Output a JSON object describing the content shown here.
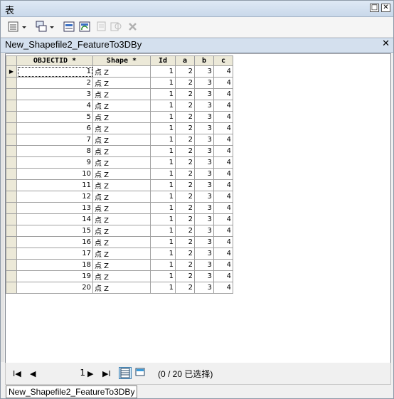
{
  "window": {
    "title": "表",
    "restore_glyph": "□",
    "close_glyph": "✕"
  },
  "toolbar": {
    "icons": [
      "table-options-icon",
      "related-tables-icon",
      "select-by-attributes-icon",
      "switch-selection-icon",
      "clear-selection-icon",
      "zoom-to-selected-icon",
      "delete-selected-icon"
    ]
  },
  "tab": {
    "title": "New_Shapefile2_FeatureTo3DBy",
    "close_glyph": "✕"
  },
  "table": {
    "columns": [
      "OBJECTID *",
      "Shape *",
      "Id",
      "a",
      "b",
      "c"
    ],
    "rows": [
      [
        "1",
        "点 Z",
        "1",
        "2",
        "3",
        "4"
      ],
      [
        "2",
        "点 Z",
        "1",
        "2",
        "3",
        "4"
      ],
      [
        "3",
        "点 Z",
        "1",
        "2",
        "3",
        "4"
      ],
      [
        "4",
        "点 Z",
        "1",
        "2",
        "3",
        "4"
      ],
      [
        "5",
        "点 Z",
        "1",
        "2",
        "3",
        "4"
      ],
      [
        "6",
        "点 Z",
        "1",
        "2",
        "3",
        "4"
      ],
      [
        "7",
        "点 Z",
        "1",
        "2",
        "3",
        "4"
      ],
      [
        "8",
        "点 Z",
        "1",
        "2",
        "3",
        "4"
      ],
      [
        "9",
        "点 Z",
        "1",
        "2",
        "3",
        "4"
      ],
      [
        "10",
        "点 Z",
        "1",
        "2",
        "3",
        "4"
      ],
      [
        "11",
        "点 Z",
        "1",
        "2",
        "3",
        "4"
      ],
      [
        "12",
        "点 Z",
        "1",
        "2",
        "3",
        "4"
      ],
      [
        "13",
        "点 Z",
        "1",
        "2",
        "3",
        "4"
      ],
      [
        "14",
        "点 Z",
        "1",
        "2",
        "3",
        "4"
      ],
      [
        "15",
        "点 Z",
        "1",
        "2",
        "3",
        "4"
      ],
      [
        "16",
        "点 Z",
        "1",
        "2",
        "3",
        "4"
      ],
      [
        "17",
        "点 Z",
        "1",
        "2",
        "3",
        "4"
      ],
      [
        "18",
        "点 Z",
        "1",
        "2",
        "3",
        "4"
      ],
      [
        "19",
        "点 Z",
        "1",
        "2",
        "3",
        "4"
      ],
      [
        "20",
        "点 Z",
        "1",
        "2",
        "3",
        "4"
      ]
    ],
    "current_row_glyph": "▶"
  },
  "nav": {
    "first_glyph": "I◀",
    "prev_glyph": "◀",
    "record": "1",
    "next_glyph": "▶",
    "last_glyph": "▶I",
    "selection_status": "(0 / 20 已选择)"
  },
  "bottom_tab": {
    "label": "New_Shapefile2_FeatureTo3DBy"
  }
}
